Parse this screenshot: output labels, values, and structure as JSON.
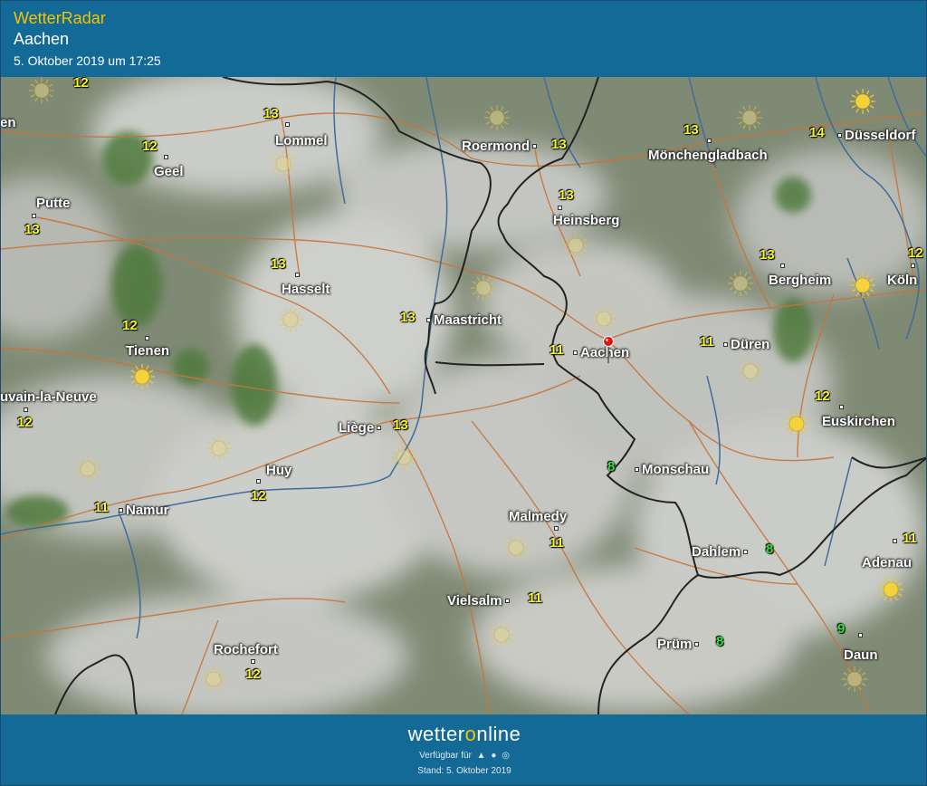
{
  "header": {
    "app_title": "WetterRadar",
    "location": "Aachen",
    "timestamp": "5. Oktober 2019 um 17:25"
  },
  "map": {
    "cities": [
      {
        "name": "Lommel",
        "temp": "13"
      },
      {
        "name": "Roermond",
        "temp": "13"
      },
      {
        "name": "Mönchengladbach",
        "temp": "13"
      },
      {
        "name": "Düsseldorf",
        "temp": "14"
      },
      {
        "name": "Geel",
        "temp": "12"
      },
      {
        "name": "Putte",
        "temp": "13"
      },
      {
        "name": "Heinsberg",
        "temp": "13"
      },
      {
        "name": "Hasselt",
        "temp": "13"
      },
      {
        "name": "Bergheim",
        "temp": "13"
      },
      {
        "name": "Köln",
        "temp": "12"
      },
      {
        "name": "Maastricht",
        "temp": "13"
      },
      {
        "name": "Tienen",
        "temp": "12"
      },
      {
        "name": "Aachen",
        "temp": "11"
      },
      {
        "name": "Düren",
        "temp": "11"
      },
      {
        "name": "uvain-la-Neuve",
        "temp": "12"
      },
      {
        "name": "Liège",
        "temp": "13"
      },
      {
        "name": "Euskirchen",
        "temp": "12"
      },
      {
        "name": "Huy",
        "temp": "12"
      },
      {
        "name": "Monschau",
        "temp": "8"
      },
      {
        "name": "Namur",
        "temp": "11"
      },
      {
        "name": "Malmedy",
        "temp": "11"
      },
      {
        "name": "Dahlem",
        "temp": "8"
      },
      {
        "name": "Adenau",
        "temp": "11"
      },
      {
        "name": "Vielsalm",
        "temp": "11"
      },
      {
        "name": "Prüm",
        "temp": "8"
      },
      {
        "name": "Daun",
        "temp": "9"
      },
      {
        "name": "Rochefort",
        "temp": "12"
      },
      {
        "name": "en",
        "temp": ""
      }
    ],
    "extra_temps": [
      "12",
      "12"
    ],
    "marker_location": "Aachen",
    "colors": {
      "cloud": "#c4c6c1",
      "land": "#5b7a48",
      "road": "#c7743a",
      "river": "#3f6c9a",
      "border": "#222222",
      "temp_warm": "#f5f52a",
      "temp_cool": "#35e23a"
    }
  },
  "footer": {
    "logo_pre": "wetter",
    "logo_o": "o",
    "logo_post": "nline",
    "available_label": "Verfügbar für",
    "platform_icons": [
      "android-icon",
      "apple-icon",
      "web-icon"
    ],
    "stand": "Stand: 5. Oktober 2019"
  }
}
